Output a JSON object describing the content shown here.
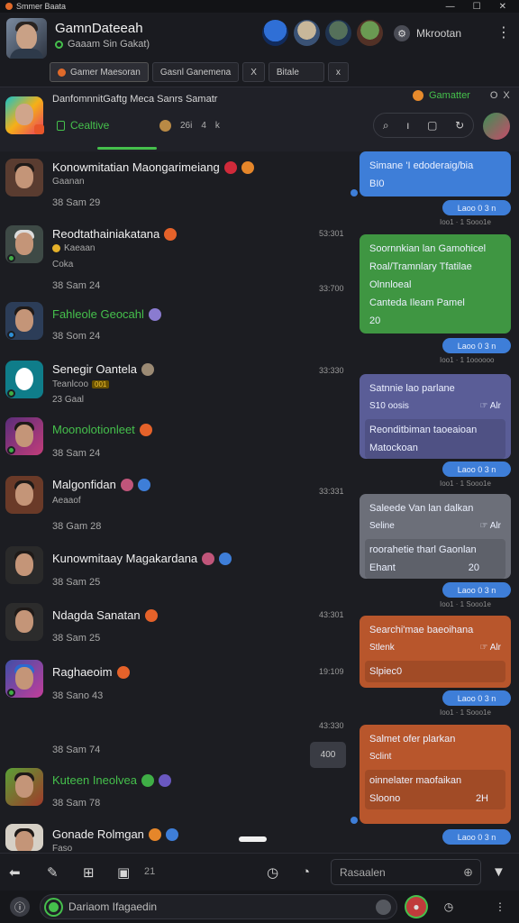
{
  "window": {
    "title": "Smmer Baata",
    "controls": [
      "—",
      "☐",
      "✕"
    ]
  },
  "profile": {
    "name": "GamnDateeah",
    "status": "Gaaam Sin Gakat)"
  },
  "header": {
    "settings_label": "Mkrootan",
    "tabs": [
      "Gamer Maesoran",
      "Gasnl Ganemena",
      "X",
      "Bitale",
      "x"
    ]
  },
  "channel": {
    "title": "DanfomnnitGaftg Meca Sanrs Samatr",
    "active_tab": "Cealtive",
    "mini_labels": [
      "26i",
      "4",
      "k"
    ],
    "live_label": "Gamatter",
    "close_labels": [
      "O",
      "X"
    ]
  },
  "messages": [
    {
      "name": "Konowmitatian Maongarimeiang",
      "sub": "Gaanan",
      "meta": "38 Sam 29",
      "time": "",
      "green": false
    },
    {
      "name": "Reodtathainiakatana",
      "sub": "Kaeaan",
      "sub2": "Coka",
      "meta": "38 Sam 24",
      "time": "53:301",
      "green": false
    },
    {
      "name": "Fahleole Geocahl",
      "sub": "",
      "meta": "38 Som 24",
      "time": "33:700",
      "green": true
    },
    {
      "name": "Senegir Oantela",
      "sub": "Teanlcoo",
      "badge": "001",
      "sub2": "23 Gaal",
      "meta": "",
      "time": "33:330",
      "green": false
    },
    {
      "name": "Moonolotionleet",
      "sub": "",
      "meta": "38 Sam 24",
      "time": "",
      "green": true
    },
    {
      "name": "Malgonfidan",
      "sub": "Aeaaof",
      "meta": "38 Gam 28",
      "time": "33:331",
      "green": false
    },
    {
      "name": "Kunowmitaay Magakardana",
      "sub": "",
      "meta": "38 Sam 25",
      "time": "",
      "green": false
    },
    {
      "name": "Ndagda Sanatan",
      "sub": "",
      "meta": "38 Sam 25",
      "time": "43:301",
      "green": false
    },
    {
      "name": "Raghaeoim",
      "sub": "",
      "meta": "38 Sano 43",
      "time": "19:109",
      "green": false
    },
    {
      "name": "",
      "sub": "",
      "meta": "38 Sam 74",
      "time": "43:330",
      "green": false
    },
    {
      "name": "Kuteen Ineolvea",
      "sub": "",
      "meta": "38 Sam 78",
      "time": "",
      "green": true
    },
    {
      "name": "Gonade Rolmgan",
      "sub": "Faso",
      "meta": "",
      "time": "",
      "green": false
    }
  ],
  "bubbles": [
    {
      "color": "blue",
      "line1": "Simane 'I edoderaig/bia",
      "line2": "BI0",
      "pill": "Laoo 0 3 n",
      "ts": "Ioo1 · 1 Sooo1e"
    },
    {
      "color": "green",
      "line1": "Soornnkian lan Gamohicel",
      "line2": "Roal/Tramnlary Tfatilae",
      "line3": "Olnnloeal",
      "line4": "Canteda Ileam Pamel",
      "line5": "20",
      "pill": "Laoo 0 3 n",
      "ts": "Ioo1 · 1 1oooooo"
    },
    {
      "color": "purple",
      "line1": "Satnnie lao parlane",
      "sub_l": "S10 oosis",
      "sub_r": "☞ Alr",
      "line3": "Reonditbiman taoeaioan",
      "line4": "Matockoan",
      "pill": "Laoo 0 3 n",
      "ts": "Ioo1 · 1 Sooo1e"
    },
    {
      "color": "gray",
      "line1": "Saleede Van lan dalkan",
      "sub_l": "Seline",
      "sub_r": "☞ Alr",
      "line3": "roorahetie tharl Gaonlan",
      "line4": "Ehant",
      "line4_r": "20",
      "pill": "Laoo 0 3 n",
      "ts": "Ioo1 · 1 Sooo1e"
    },
    {
      "color": "orange",
      "line1": "Searchi'mae baeoihana",
      "sub_l": "Stlenk",
      "sub_r": "☞ Alr",
      "line3": "Slpiec0",
      "pill": "Laoo 0 3 n",
      "ts": "Ioo1 · 1 Sooo1e"
    },
    {
      "color": "orange",
      "line1": "Salmet ofer plarkan",
      "sub_l": "Sclint",
      "line3": "oinnelater maofaikan",
      "line4": "Sloono",
      "line4_r": "2H",
      "pill": "Laoo 0 3 n",
      "ts": ""
    }
  ],
  "float_btn": "400",
  "toolbar": {
    "search_placeholder": "Rasaalen",
    "count": "21"
  },
  "compose": {
    "placeholder": "Dariaom Ifagaedin"
  },
  "colors": {
    "accent_green": "#45c04c",
    "accent_blue": "#3e7ed8",
    "accent_orange": "#b8562c"
  }
}
